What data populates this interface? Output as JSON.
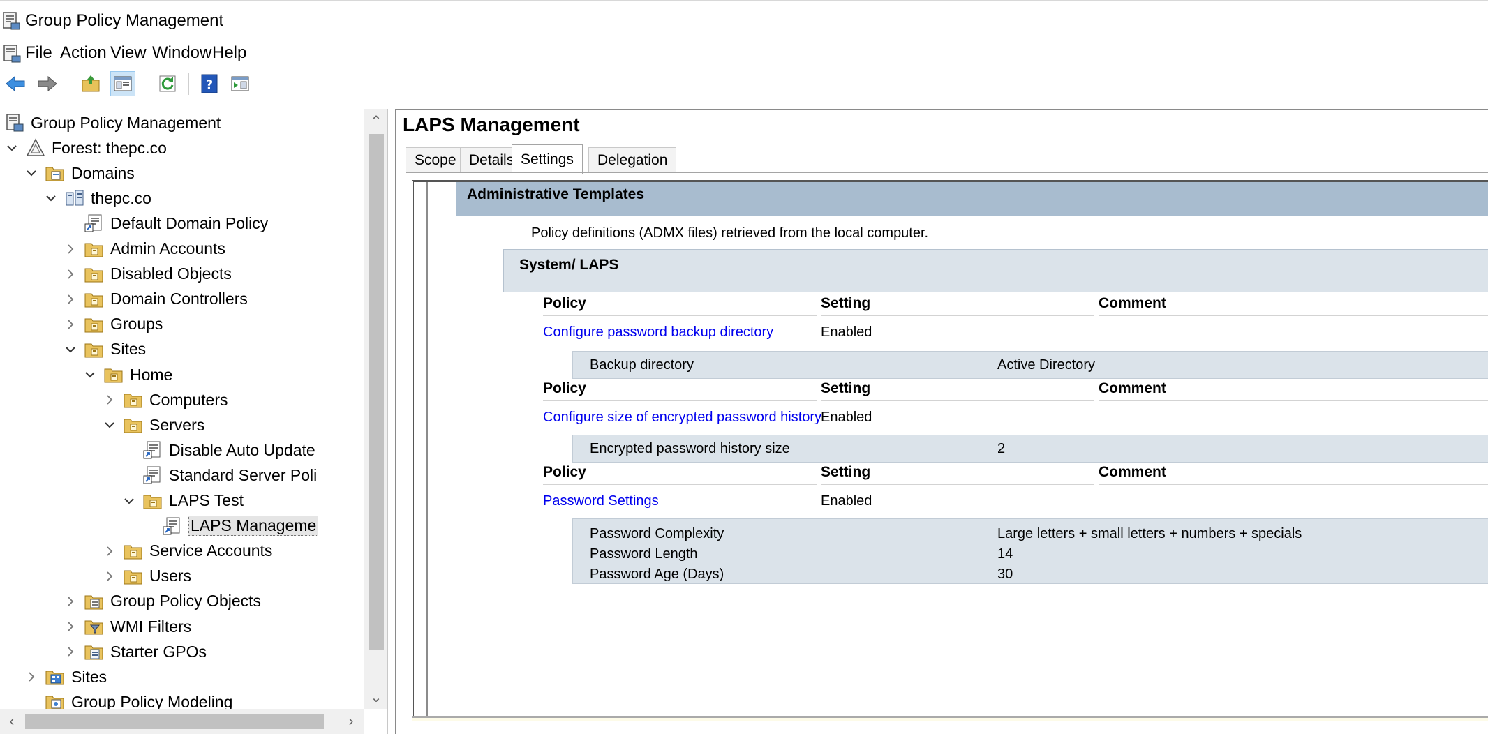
{
  "window": {
    "title": "Group Policy Management"
  },
  "menubar": {
    "items": [
      "File",
      "Action",
      "View",
      "Window",
      "Help"
    ]
  },
  "toolbar": {
    "buttons": [
      "back-arrow-icon",
      "forward-arrow-icon",
      "up-folder-icon",
      "show-hide-tree-icon",
      "refresh-icon",
      "help-icon",
      "properties-pane-icon"
    ]
  },
  "tree": {
    "nodes": [
      {
        "label": "Group Policy Management",
        "level": 0,
        "expander": "none",
        "icon": "gpm-icon"
      },
      {
        "label": "Forest: thepc.co",
        "level": 1,
        "expander": "expanded",
        "icon": "forest-icon"
      },
      {
        "label": "Domains",
        "level": 2,
        "expander": "expanded",
        "icon": "domains-folder-icon"
      },
      {
        "label": "thepc.co",
        "level": 3,
        "expander": "expanded",
        "icon": "domain-icon"
      },
      {
        "label": "Default Domain Policy",
        "level": 4,
        "expander": "none",
        "icon": "gpo-link-icon"
      },
      {
        "label": "Admin Accounts",
        "level": 4,
        "expander": "collapsed",
        "icon": "ou-folder-icon"
      },
      {
        "label": "Disabled Objects",
        "level": 4,
        "expander": "collapsed",
        "icon": "ou-folder-icon"
      },
      {
        "label": "Domain Controllers",
        "level": 4,
        "expander": "collapsed",
        "icon": "ou-folder-icon"
      },
      {
        "label": "Groups",
        "level": 4,
        "expander": "collapsed",
        "icon": "ou-folder-icon"
      },
      {
        "label": "Sites",
        "level": 4,
        "expander": "expanded",
        "icon": "ou-folder-icon"
      },
      {
        "label": "Home",
        "level": 5,
        "expander": "expanded",
        "icon": "ou-folder-icon"
      },
      {
        "label": "Computers",
        "level": 6,
        "expander": "collapsed",
        "icon": "ou-folder-icon"
      },
      {
        "label": "Servers",
        "level": 6,
        "expander": "expanded",
        "icon": "ou-folder-icon"
      },
      {
        "label": "Disable Auto Update",
        "level": 7,
        "expander": "none",
        "icon": "gpo-link-icon"
      },
      {
        "label": "Standard Server Poli",
        "level": 7,
        "expander": "none",
        "icon": "gpo-link-icon"
      },
      {
        "label": "LAPS Test",
        "level": 7,
        "expander": "expanded",
        "icon": "ou-folder-icon"
      },
      {
        "label": "LAPS Manageme",
        "level": 8,
        "expander": "none",
        "icon": "gpo-link-icon",
        "selected": true
      },
      {
        "label": "Service Accounts",
        "level": 6,
        "expander": "collapsed",
        "icon": "ou-folder-icon"
      },
      {
        "label": "Users",
        "level": 6,
        "expander": "collapsed",
        "icon": "ou-folder-icon"
      },
      {
        "label": "Group Policy Objects",
        "level": 4,
        "expander": "collapsed",
        "icon": "gpo-container-icon"
      },
      {
        "label": "WMI Filters",
        "level": 4,
        "expander": "collapsed",
        "icon": "wmi-filter-icon"
      },
      {
        "label": "Starter GPOs",
        "level": 4,
        "expander": "collapsed",
        "icon": "starter-gpo-icon"
      },
      {
        "label": "Sites",
        "level": 2,
        "expander": "collapsed",
        "icon": "sites-icon"
      },
      {
        "label": "Group Policy Modeling",
        "level": 2,
        "expander": "none",
        "icon": "modeling-icon"
      }
    ]
  },
  "details": {
    "gpo_title": "LAPS Management",
    "tabs": [
      "Scope",
      "Details",
      "Settings",
      "Delegation"
    ],
    "active_tab": "Settings",
    "report": {
      "section": "Administrative Templates",
      "note": "Policy definitions (ADMX files) retrieved from the local computer.",
      "subsection": "System/ LAPS",
      "columns": {
        "policy": "Policy",
        "setting": "Setting",
        "comment": "Comment"
      },
      "policies": [
        {
          "name": "Configure password backup directory",
          "setting": "Enabled",
          "details": [
            {
              "name": "Backup directory",
              "value": "Active Directory"
            }
          ]
        },
        {
          "name": "Configure size of encrypted password history",
          "setting": "Enabled",
          "details": [
            {
              "name": "Encrypted password history size",
              "value": "2"
            }
          ]
        },
        {
          "name": "Password Settings",
          "setting": "Enabled",
          "details": [
            {
              "name": "Password Complexity",
              "value": "Large letters + small letters + numbers + specials"
            },
            {
              "name": "Password Length",
              "value": "14"
            },
            {
              "name": "Password Age (Days)",
              "value": "30"
            }
          ]
        }
      ]
    }
  },
  "colors": {
    "section_header": "#a8bccf",
    "subsection": "#dbe3ea",
    "link": "#0000ee",
    "selection": "#e5e5e5"
  }
}
